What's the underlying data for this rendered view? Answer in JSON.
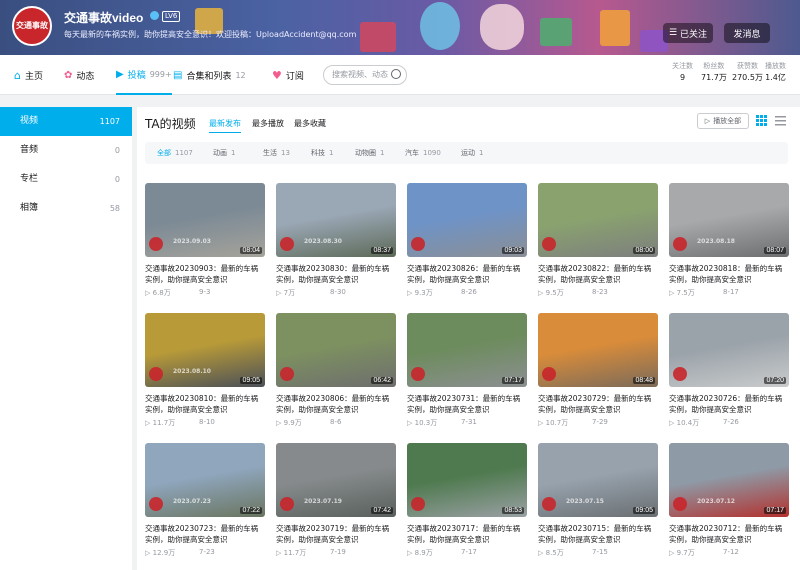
{
  "profile": {
    "name": "交通事故video",
    "level": "LV6",
    "avatar_text": "交通事故",
    "sign": "每天最新的车祸实例，助你提高安全意识！欢迎投稿：UploadAccident@qq.com",
    "follow_label": "已关注",
    "message_label": "发消息"
  },
  "nav": {
    "home": "主页",
    "dynamic": "动态",
    "videos": "投稿",
    "videos_count": "999+",
    "collections": "合集和列表",
    "collections_count": "12",
    "subscriptions": "订阅",
    "search_placeholder": "搜索视频、动态"
  },
  "stats": [
    {
      "label": "关注数",
      "value": "9"
    },
    {
      "label": "粉丝数",
      "value": "71.7万"
    },
    {
      "label": "获赞数",
      "value": "270.5万"
    },
    {
      "label": "播放数",
      "value": "1.4亿"
    }
  ],
  "sidebar": [
    {
      "label": "视频",
      "count": "1107"
    },
    {
      "label": "音频",
      "count": "0"
    },
    {
      "label": "专栏",
      "count": "0"
    },
    {
      "label": "相簿",
      "count": "58"
    }
  ],
  "main": {
    "title": "TA的视频",
    "sort": [
      "最新发布",
      "最多播放",
      "最多收藏"
    ],
    "play_all": "播放全部"
  },
  "filters": [
    {
      "label": "全部",
      "count": "1107"
    },
    {
      "label": "动画",
      "count": "1"
    },
    {
      "label": "生活",
      "count": "13"
    },
    {
      "label": "科技",
      "count": "1"
    },
    {
      "label": "动物圈",
      "count": "1"
    },
    {
      "label": "汽车",
      "count": "1090"
    },
    {
      "label": "运动",
      "count": "1"
    }
  ],
  "colors": {
    "accent": "#00aeec",
    "like_red": "#f25d8e"
  },
  "videos": [
    {
      "title": "交通事故20230903：最新的车祸实例，助你提高安全意识",
      "duration": "08:04",
      "plays": "6.8万",
      "date": "9-3",
      "thumb_date": "2023.09.03",
      "c1": "#7c8a96",
      "c2": "#a5a39a"
    },
    {
      "title": "交通事故20230830：最新的车祸实例，助你提高安全意识",
      "duration": "08:37",
      "plays": "7万",
      "date": "8-30",
      "thumb_date": "2023.08.30",
      "c1": "#9aa7b5",
      "c2": "#5d6a58"
    },
    {
      "title": "交通事故20230826：最新的车祸实例，助你提高安全意识",
      "duration": "09:03",
      "plays": "9.3万",
      "date": "8-26",
      "thumb_date": "",
      "c1": "#6e93c7",
      "c2": "#8b8f95"
    },
    {
      "title": "交通事故20230822：最新的车祸实例，助你提高安全意识",
      "duration": "08:00",
      "plays": "9.5万",
      "date": "8-23",
      "thumb_date": "",
      "c1": "#8aa36e",
      "c2": "#7d7f7e"
    },
    {
      "title": "交通事故20230818：最新的车祸实例，助你提高安全意识",
      "duration": "08:07",
      "plays": "7.5万",
      "date": "8-17",
      "thumb_date": "2023.08.18",
      "c1": "#a7a9ab",
      "c2": "#6c6e70"
    },
    {
      "title": "交通事故20230810：最新的车祸实例，助你提高安全意识",
      "duration": "09:05",
      "plays": "11.7万",
      "date": "8-10",
      "thumb_date": "2023.08.10",
      "c1": "#b89a38",
      "c2": "#4a5058"
    },
    {
      "title": "交通事故20230806：最新的车祸实例，助你提高安全意识",
      "duration": "06:42",
      "plays": "9.9万",
      "date": "8-6",
      "thumb_date": "",
      "c1": "#7d9160",
      "c2": "#6e6e6e"
    },
    {
      "title": "交通事故20230731：最新的车祸实例，助你提高安全意识",
      "duration": "07:17",
      "plays": "10.3万",
      "date": "7-31",
      "thumb_date": "",
      "c1": "#6d8c5e",
      "c2": "#8c8f91"
    },
    {
      "title": "交通事故20230729：最新的车祸实例，助你提高安全意识",
      "duration": "08:48",
      "plays": "10.7万",
      "date": "7-29",
      "thumb_date": "",
      "c1": "#d98c3a",
      "c2": "#7b6b5a"
    },
    {
      "title": "交通事故20230726：最新的车祸实例，助你提高安全意识",
      "duration": "07:20",
      "plays": "10.4万",
      "date": "7-26",
      "thumb_date": "",
      "c1": "#9ba3aa",
      "c2": "#c9cbcc"
    },
    {
      "title": "交通事故20230723：最新的车祸实例，助你提高安全意识",
      "duration": "07:22",
      "plays": "12.9万",
      "date": "7-23",
      "thumb_date": "2023.07.23",
      "c1": "#8fa6bd",
      "c2": "#6a7560"
    },
    {
      "title": "交通事故20230719：最新的车祸实例，助你提高安全意识",
      "duration": "07:42",
      "plays": "11.7万",
      "date": "7-19",
      "thumb_date": "2023.07.19",
      "c1": "#868a8c",
      "c2": "#59605c"
    },
    {
      "title": "交通事故20230717：最新的车祸实例，助你提高安全意识",
      "duration": "08:53",
      "plays": "8.9万",
      "date": "7-17",
      "thumb_date": "",
      "c1": "#4f7a4f",
      "c2": "#9aa0a4"
    },
    {
      "title": "交通事故20230715：最新的车祸实例，助你提高安全意识",
      "duration": "09:05",
      "plays": "8.5万",
      "date": "7-15",
      "thumb_date": "2023.07.15",
      "c1": "#97a2ad",
      "c2": "#6a6f72"
    },
    {
      "title": "交通事故20230712：最新的车祸实例，助你提高安全意识",
      "duration": "07:17",
      "plays": "9.7万",
      "date": "7-12",
      "thumb_date": "2023.07.12",
      "c1": "#8e9aa6",
      "c2": "#b3312e"
    }
  ]
}
